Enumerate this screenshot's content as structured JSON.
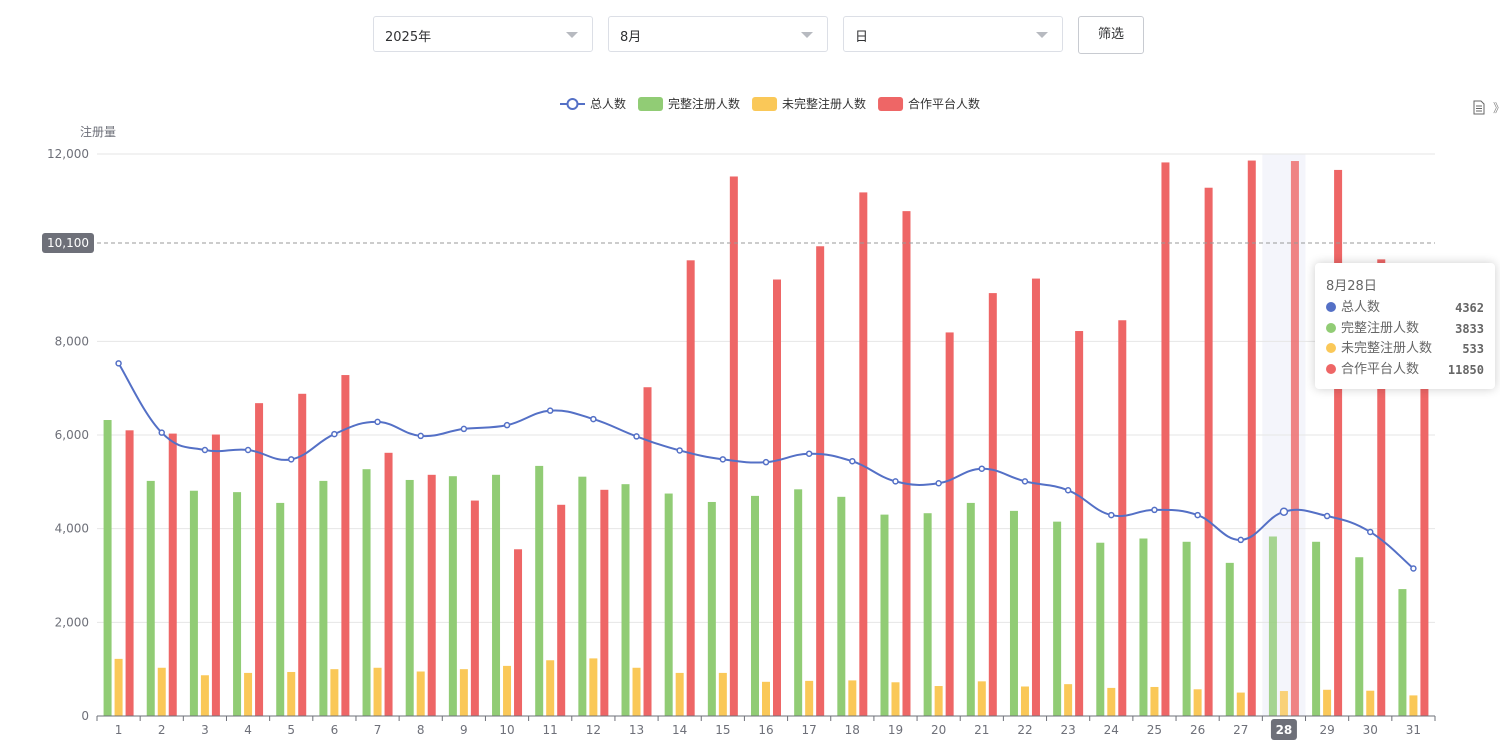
{
  "filters": {
    "year": "2025年",
    "month": "8月",
    "granularity": "日",
    "filter_button": "筛选"
  },
  "toolbox_partial_text": "》",
  "chart_data": {
    "type": "bar",
    "ylabel": "注册量",
    "ylim": [
      0,
      12000
    ],
    "yticks": [
      "0",
      "2,000",
      "4,000",
      "6,000",
      "8,000",
      "12,000"
    ],
    "categories": [
      "1",
      "2",
      "3",
      "4",
      "5",
      "6",
      "7",
      "8",
      "9",
      "10",
      "11",
      "12",
      "13",
      "14",
      "15",
      "16",
      "17",
      "18",
      "19",
      "20",
      "21",
      "22",
      "23",
      "24",
      "25",
      "26",
      "27",
      "28",
      "29",
      "30",
      "31"
    ],
    "series": [
      {
        "name": "总人数",
        "kind": "line",
        "color": "#5470c6",
        "values": [
          7530,
          6050,
          5680,
          5680,
          5480,
          6020,
          6280,
          5980,
          6130,
          6210,
          6520,
          6340,
          5970,
          5670,
          5480,
          5420,
          5600,
          5440,
          5010,
          4970,
          5280,
          5010,
          4820,
          4290,
          4400,
          4290,
          3760,
          4362,
          4270,
          3930,
          3150
        ]
      },
      {
        "name": "完整注册人数",
        "kind": "bar",
        "color": "#91cc75",
        "values": [
          6320,
          5020,
          4810,
          4780,
          4550,
          5020,
          5270,
          5040,
          5120,
          5150,
          5340,
          5110,
          4950,
          4750,
          4570,
          4700,
          4840,
          4680,
          4300,
          4330,
          4550,
          4380,
          4150,
          3700,
          3790,
          3720,
          3270,
          3833,
          3720,
          3390,
          2710
        ]
      },
      {
        "name": "未完整注册人数",
        "kind": "bar",
        "color": "#fac858",
        "values": [
          1220,
          1030,
          870,
          920,
          940,
          1000,
          1030,
          950,
          1000,
          1070,
          1190,
          1230,
          1030,
          920,
          920,
          730,
          750,
          760,
          720,
          640,
          740,
          630,
          680,
          600,
          620,
          570,
          500,
          533,
          560,
          540,
          440
        ]
      },
      {
        "name": "合作平台人数",
        "kind": "bar",
        "color": "#ee6666",
        "values": [
          6100,
          6030,
          6010,
          6680,
          6880,
          7280,
          5620,
          5150,
          4600,
          3560,
          4510,
          4830,
          7020,
          9730,
          11520,
          9320,
          10030,
          11180,
          10780,
          8190,
          9030,
          9340,
          8220,
          8450,
          11820,
          11280,
          11860,
          11850,
          11660,
          9750,
          7000
        ]
      }
    ],
    "markline": {
      "value": 10100,
      "label": "10,100"
    },
    "highlighted_category": "28",
    "legend_position": "top-center",
    "grid": true,
    "tooltip": {
      "title": "8月28日",
      "rows": [
        {
          "name": "总人数",
          "value": "4362",
          "color": "#5470c6"
        },
        {
          "name": "完整注册人数",
          "value": "3833",
          "color": "#91cc75"
        },
        {
          "name": "未完整注册人数",
          "value": "533",
          "color": "#fac858"
        },
        {
          "name": "合作平台人数",
          "value": "11850",
          "color": "#ee6666"
        }
      ]
    }
  }
}
